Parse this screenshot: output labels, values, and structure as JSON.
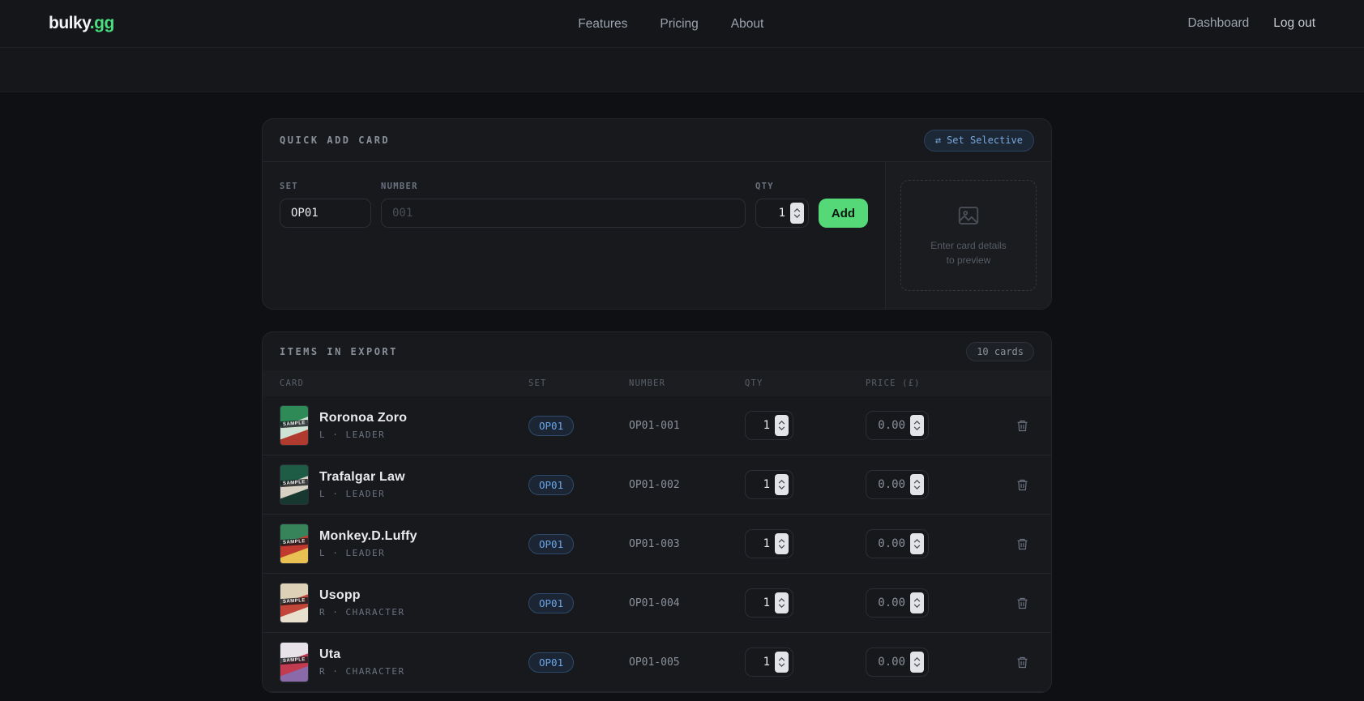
{
  "brand": {
    "name": "bulky",
    "tld": ".gg"
  },
  "colors": {
    "accent_green": "#4ade80",
    "add_button_green": "#55d978",
    "badge_blue": "#6aa5e8"
  },
  "nav": {
    "links": [
      {
        "label": "Features"
      },
      {
        "label": "Pricing"
      },
      {
        "label": "About"
      }
    ],
    "dashboard_label": "Dashboard",
    "logout_label": "Log out"
  },
  "quick_add": {
    "title": "QUICK ADD CARD",
    "set_selective": {
      "icon": "⇄",
      "label": "Set Selective"
    },
    "set_label": "SET",
    "set_value": "OP01",
    "number_label": "NUMBER",
    "number_placeholder": "001",
    "qty_label": "QTY",
    "qty_value": "1",
    "add_label": "Add",
    "preview_line1": "Enter card details",
    "preview_line2": "to preview"
  },
  "export": {
    "title": "ITEMS IN EXPORT",
    "count_badge": "10 cards",
    "sample_label": "SAMPLE",
    "columns": [
      "CARD",
      "SET",
      "NUMBER",
      "QTY",
      "PRICE (£)"
    ],
    "rows": [
      {
        "name": "Roronoa Zoro",
        "rarity": "L",
        "sep": "·",
        "type": "LEADER",
        "set": "OP01",
        "number": "OP01-001",
        "qty": "1",
        "price": "0.00",
        "thumb_colors": [
          "#2e8b57",
          "#cfe3d4",
          "#b03a2e"
        ]
      },
      {
        "name": "Trafalgar Law",
        "rarity": "L",
        "sep": "·",
        "type": "LEADER",
        "set": "OP01",
        "number": "OP01-002",
        "qty": "1",
        "price": "0.00",
        "thumb_colors": [
          "#1e5c46",
          "#d8d2c4",
          "#17382e"
        ]
      },
      {
        "name": "Monkey.D.Luffy",
        "rarity": "L",
        "sep": "·",
        "type": "LEADER",
        "set": "OP01",
        "number": "OP01-003",
        "qty": "1",
        "price": "0.00",
        "thumb_colors": [
          "#37835a",
          "#c03a30",
          "#e8c152"
        ]
      },
      {
        "name": "Usopp",
        "rarity": "R",
        "sep": "·",
        "type": "CHARACTER",
        "set": "OP01",
        "number": "OP01-004",
        "qty": "1",
        "price": "0.00",
        "thumb_colors": [
          "#ddd2b8",
          "#c2473a",
          "#e8e0cc"
        ]
      },
      {
        "name": "Uta",
        "rarity": "R",
        "sep": "·",
        "type": "CHARACTER",
        "set": "OP01",
        "number": "OP01-005",
        "qty": "1",
        "price": "0.00",
        "thumb_colors": [
          "#e6e2e8",
          "#c23b50",
          "#8a6aa8"
        ]
      }
    ]
  }
}
